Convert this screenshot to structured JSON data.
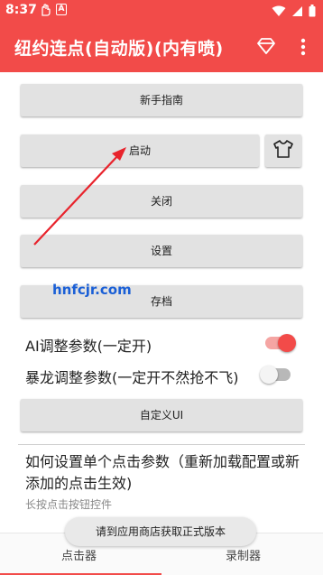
{
  "status_bar": {
    "time": "8:37",
    "icons_left": [
      "hand-icon",
      "a-badge-icon"
    ],
    "a_badge_text": "A",
    "icons_right": [
      "wifi-icon",
      "signal-icon",
      "battery-icon"
    ]
  },
  "app_bar": {
    "title": "纽约连点(自动版)(内有喷)",
    "icons": [
      "diamond-icon",
      "more-vert-icon"
    ],
    "background": "#f24b49"
  },
  "buttons": {
    "guide": "新手指南",
    "start": "启动",
    "close": "关闭",
    "settings": "设置",
    "save": "存档",
    "custom_ui": "自定义UI"
  },
  "toggles": [
    {
      "label": "AI调整参数(一定开)",
      "on": true
    },
    {
      "label": "暴龙调整参数(一定开不然抢不飞)",
      "on": false
    }
  ],
  "info": {
    "title": "如何设置单个点击参数（重新加载配置或新添加的点击生效)",
    "subtitle": "长按点击按钮控件"
  },
  "bottom_nav": {
    "left": "点击器",
    "right": "录制器",
    "active": "left"
  },
  "toast": "请到应用商店获取正式版本",
  "watermark": "hnfcjr.com",
  "colors": {
    "accent": "#f24b49",
    "button_bg": "#e2e2e2",
    "arrow": "#e8232c",
    "watermark": "#1a5fd6"
  }
}
